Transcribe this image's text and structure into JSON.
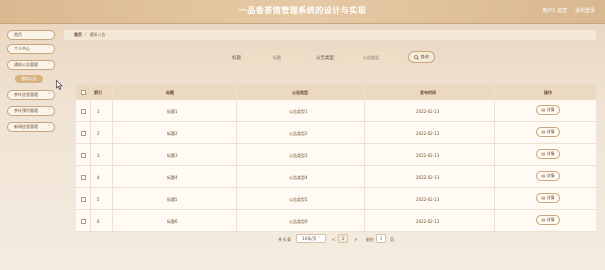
{
  "header": {
    "title": "一品香茶馆管理系统的设计与实现",
    "user_label": "用户1 运营",
    "logout_label": "退出登录"
  },
  "sidebar": {
    "items": [
      {
        "label": "首页",
        "has_chevron": false
      },
      {
        "label": "个人中心",
        "has_chevron": true
      },
      {
        "label": "通知公告管理",
        "has_chevron": true
      },
      {
        "label": "茶叶信息管理",
        "has_chevron": true
      },
      {
        "label": "茶叶预约管理",
        "has_chevron": true
      },
      {
        "label": "新闻信息管理",
        "has_chevron": true
      }
    ],
    "active_sub": "通知公告",
    "chevron": "˅"
  },
  "breadcrumb": {
    "home": "首页",
    "current": "通知公告"
  },
  "search": {
    "title_label": "标题",
    "title_placeholder": "标题",
    "type_label": "公告类型",
    "type_placeholder": "公告类型",
    "button_label": "查询",
    "button_icon": "search-icon"
  },
  "table": {
    "headers": [
      "索引",
      "标题",
      "公告类型",
      "发布时间",
      "操作"
    ],
    "rows": [
      {
        "index": "1",
        "title": "标题1",
        "type": "公告类型1",
        "date": "2022-02-13",
        "action": "详情"
      },
      {
        "index": "2",
        "title": "标题2",
        "type": "公告类型2",
        "date": "2022-02-13",
        "action": "详情"
      },
      {
        "index": "3",
        "title": "标题3",
        "type": "公告类型3",
        "date": "2022-02-13",
        "action": "详情"
      },
      {
        "index": "4",
        "title": "标题4",
        "type": "公告类型4",
        "date": "2022-02-13",
        "action": "详情"
      },
      {
        "index": "5",
        "title": "标题5",
        "type": "公告类型5",
        "date": "2022-02-13",
        "action": "详情"
      },
      {
        "index": "6",
        "title": "标题6",
        "type": "公告类型6",
        "date": "2022-02-13",
        "action": "详情"
      }
    ]
  },
  "pagination": {
    "total_label": "共 6 条",
    "page_size": "10条/页",
    "prev": "<",
    "current_page": "1",
    "next": ">",
    "goto_label": "前往",
    "goto_value": "1",
    "page_suffix": "页"
  },
  "colors": {
    "accent": "#d7b27f",
    "header_bg": "#ecd9c2",
    "border": "#c9a57a"
  }
}
